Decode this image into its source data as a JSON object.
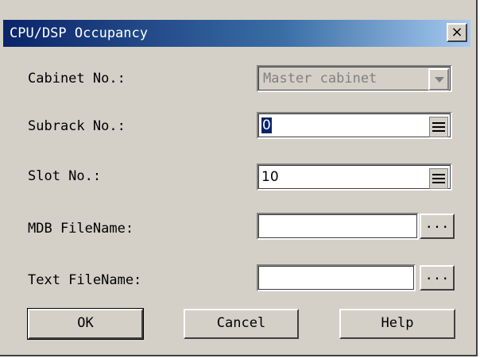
{
  "window": {
    "title": "CPU/DSP Occupancy",
    "close_glyph": "×",
    "close_icon": "close-icon"
  },
  "fields": {
    "cabinet": {
      "label": "Cabinet No.:",
      "value": "Master cabinet"
    },
    "subrack": {
      "label": "Subrack No.:",
      "value": "0"
    },
    "slot": {
      "label": "Slot No.:",
      "value": "10"
    },
    "mdb": {
      "label": "MDB FileName:",
      "value": "",
      "browse_label": "..."
    },
    "text": {
      "label": "Text FileName:",
      "value": "",
      "browse_label": "..."
    }
  },
  "buttons": {
    "ok": "OK",
    "cancel": "Cancel",
    "help": "Help"
  },
  "colors": {
    "titlebar_start": "#0a246a",
    "titlebar_end": "#a6caf0",
    "face": "#d4d0c8"
  }
}
